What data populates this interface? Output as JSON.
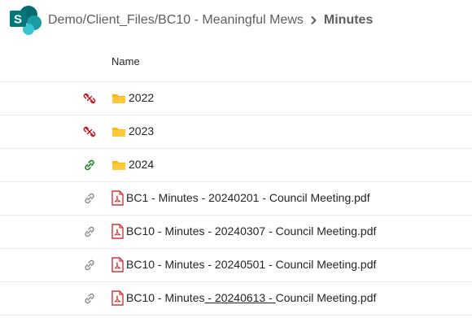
{
  "breadcrumb": {
    "path": "Demo/Client_Files/BC10 - Meaningful Mews",
    "current": "Minutes"
  },
  "columns": {
    "name": "Name"
  },
  "items": [
    {
      "type": "folder",
      "name": "2022",
      "share": "unshared"
    },
    {
      "type": "folder",
      "name": "2023",
      "share": "unshared"
    },
    {
      "type": "folder",
      "name": "2024",
      "share": "shared"
    },
    {
      "type": "pdf",
      "name": "BC1 - Minutes - 20240201 - Council Meeting.pdf",
      "share": "link"
    },
    {
      "type": "pdf",
      "name": "BC10 - Minutes - 20240307 - Council Meeting.pdf",
      "share": "link"
    },
    {
      "type": "pdf",
      "name": "BC10 - Minutes - 20240501 - Council Meeting.pdf",
      "share": "link"
    },
    {
      "type": "pdf",
      "name_parts": [
        "BC10 - Minutes",
        " - 20240613 - ",
        "Council Meeting.pdf"
      ],
      "share": "link"
    }
  ],
  "colors": {
    "unshared": "#c50f1f",
    "shared": "#107c10",
    "link": "#8a8886",
    "folder": "#ffb900",
    "pdf": "#d13438"
  }
}
